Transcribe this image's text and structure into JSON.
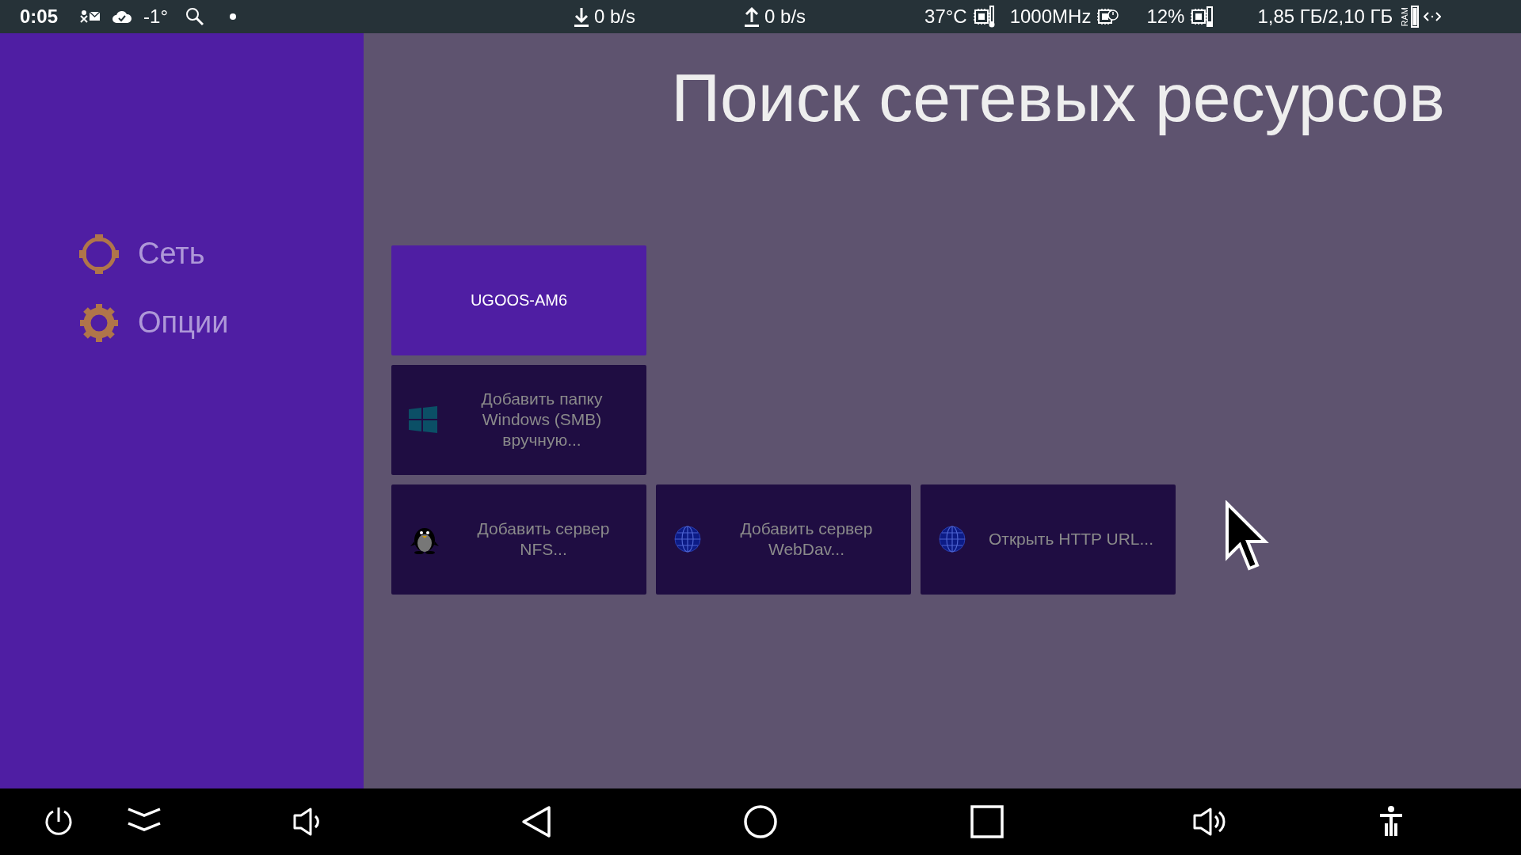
{
  "status_bar": {
    "time": "0:05",
    "weather": "-1°",
    "download": "0 b/s",
    "upload": "0 b/s",
    "cpu_temp": "37°C",
    "cpu_freq": "1000MHz",
    "cpu_load": "12%",
    "ram": "1,85 ГБ/2,10 ГБ",
    "ram_label": "RAM"
  },
  "title": "Поиск сетевых ресурсов",
  "sidebar": {
    "items": [
      {
        "label": "Сеть",
        "kind": "network"
      },
      {
        "label": "Опции",
        "kind": "options"
      }
    ]
  },
  "tile_rows": [
    {
      "tiles": [
        {
          "label": "UGOOS-AM6",
          "kind": "device"
        }
      ]
    },
    {
      "tiles": [
        {
          "label": "Добавить папку Windows (SMB) вручную...",
          "kind": "smb"
        }
      ]
    },
    {
      "tiles": [
        {
          "label": "Добавить сервер NFS...",
          "kind": "nfs"
        },
        {
          "label": "Добавить сервер WebDav...",
          "kind": "webdav"
        },
        {
          "label": "Открыть HTTP URL...",
          "kind": "http"
        }
      ]
    }
  ]
}
